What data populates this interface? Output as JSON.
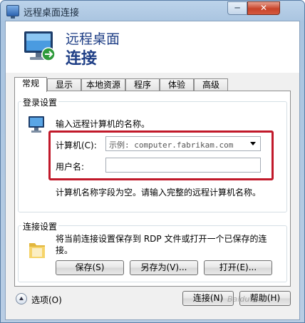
{
  "window": {
    "title": "远程桌面连接",
    "minimize_label": "─",
    "close_label": "✕"
  },
  "banner": {
    "line1": "远程桌面",
    "line2": "连接"
  },
  "tabs": [
    {
      "label": "常规",
      "active": true
    },
    {
      "label": "显示",
      "active": false
    },
    {
      "label": "本地资源",
      "active": false
    },
    {
      "label": "程序",
      "active": false
    },
    {
      "label": "体验",
      "active": false
    },
    {
      "label": "高级",
      "active": false
    }
  ],
  "login": {
    "legend": "登录设置",
    "description": "输入远程计算机的名称。",
    "computer_label": "计算机(C):",
    "computer_placeholder": "示例: computer.fabrikam.com",
    "username_label": "用户名:",
    "username_value": "",
    "warning": "计算机名称字段为空。请输入完整的远程计算机名称。"
  },
  "connection": {
    "legend": "连接设置",
    "description": "将当前连接设置保存到 RDP 文件或打开一个已保存的连接。",
    "save_label": "保存(S)",
    "saveas_label": "另存为(V)...",
    "open_label": "打开(E)..."
  },
  "footer": {
    "options_label": "选项(O)",
    "connect_label": "连接(N)",
    "help_label": "帮助(H)"
  },
  "watermark": "Baidu经验",
  "colors": {
    "highlight": "#c1192a",
    "banner_text": "#1f3f86"
  }
}
